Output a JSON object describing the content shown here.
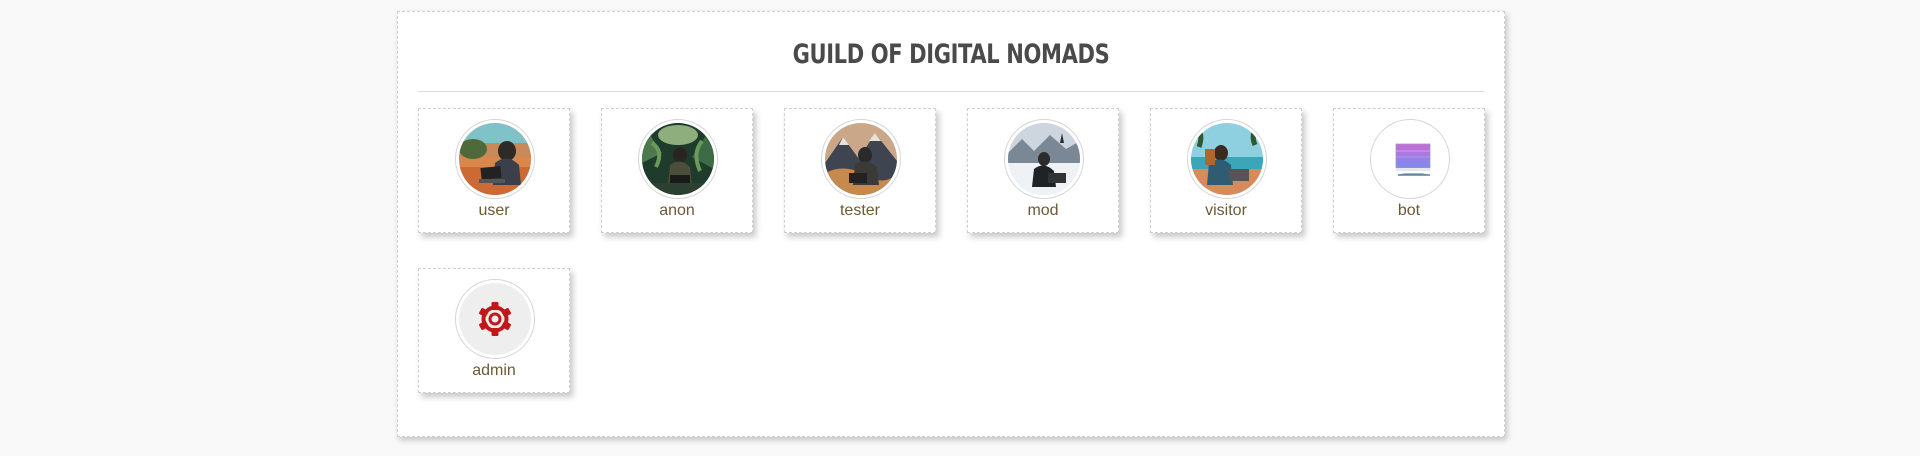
{
  "guild": {
    "title": "GUILD OF DIGITAL NOMADS"
  },
  "members": [
    {
      "label": "user",
      "icon": "photo-beach-laptop-avatar"
    },
    {
      "label": "anon",
      "icon": "photo-jungle-laptop-avatar"
    },
    {
      "label": "tester",
      "icon": "photo-mountain-laptop-avatar"
    },
    {
      "label": "mod",
      "icon": "photo-snow-laptop-avatar"
    },
    {
      "label": "visitor",
      "icon": "photo-seaside-laptop-avatar"
    },
    {
      "label": "bot",
      "icon": "monitor-icon"
    },
    {
      "label": "admin",
      "icon": "gear-icon"
    }
  ],
  "colors": {
    "background": "#f9f9f9",
    "title": "#4a4a4a",
    "label": "#6b5a34",
    "gear": "#c0191b",
    "monitor_gradient_top": "#c86bd6",
    "monitor_gradient_bottom": "#7b8cf0"
  }
}
